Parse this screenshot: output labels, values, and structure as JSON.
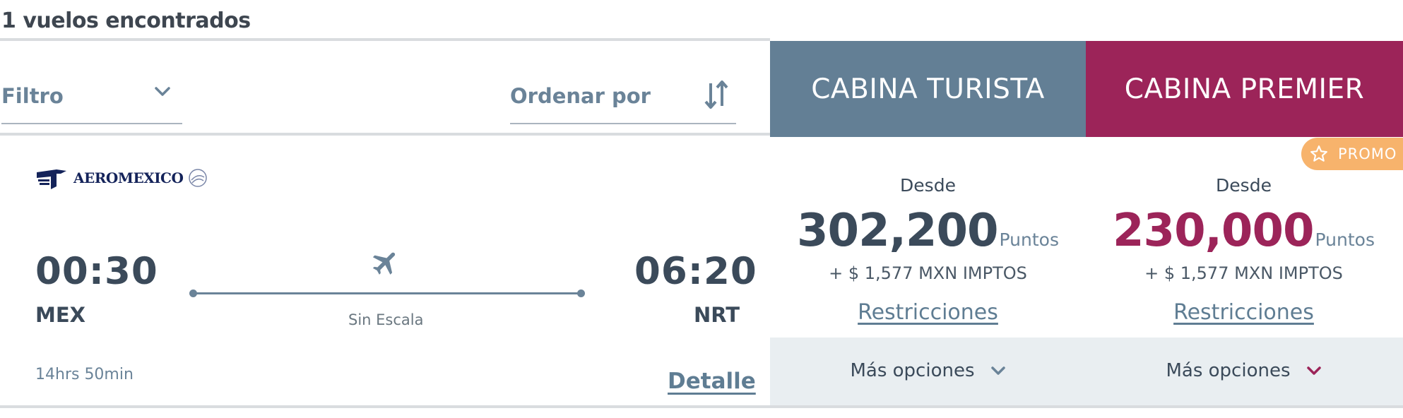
{
  "results": {
    "count_label": "1 vuelos encontrados"
  },
  "filters": {
    "filter_label": "Filtro",
    "sort_label": "Ordenar por"
  },
  "cabins": {
    "turista": {
      "label": "CABINA TURISTA",
      "color": "#637f95"
    },
    "premier": {
      "label": "CABINA PREMIER",
      "color": "#9c2459"
    }
  },
  "promo": {
    "label": "PROMO",
    "icon": "star-icon",
    "color": "#f7b36c"
  },
  "flight": {
    "airline": "AEROMEXICO",
    "departure": {
      "time": "00:30",
      "airport": "MEX"
    },
    "arrival": {
      "time": "06:20",
      "airport": "NRT"
    },
    "stops": "Sin Escala",
    "duration": "14hrs 50min",
    "detail_label": "Detalle"
  },
  "fares": [
    {
      "cabin": "turista",
      "from_label": "Desde",
      "points": "302,200",
      "points_unit": "Puntos",
      "taxes": "+ $ 1,577 MXN IMPTOS",
      "restrictions_label": "Restricciones",
      "more_options_label": "Más opciones",
      "accent": "#3b4a5a",
      "chevron_color": "#6a8398"
    },
    {
      "cabin": "premier",
      "from_label": "Desde",
      "points": "230,000",
      "points_unit": "Puntos",
      "taxes": "+ $ 1,577 MXN IMPTOS",
      "restrictions_label": "Restricciones",
      "more_options_label": "Más opciones",
      "accent": "#9c2459",
      "chevron_color": "#9c2459"
    }
  ]
}
